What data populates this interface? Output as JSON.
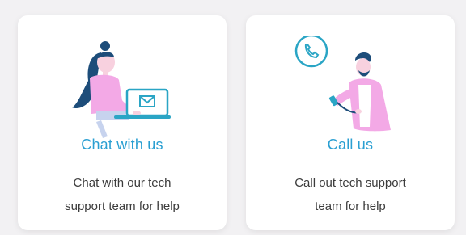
{
  "cards": [
    {
      "icon": "chat-illustration-icon",
      "title": "Chat with us",
      "desc_line1": "Chat with our tech",
      "desc_line2": "support team for help"
    },
    {
      "icon": "phone-call-illustration-icon",
      "title": "Call us",
      "desc_line1": "Call out tech support",
      "desc_line2": "team for help"
    }
  ],
  "colors": {
    "accent": "#2a9fd2",
    "pink": "#f3a9e6",
    "navy": "#1d4d7a",
    "background": "#f2f1f3"
  }
}
